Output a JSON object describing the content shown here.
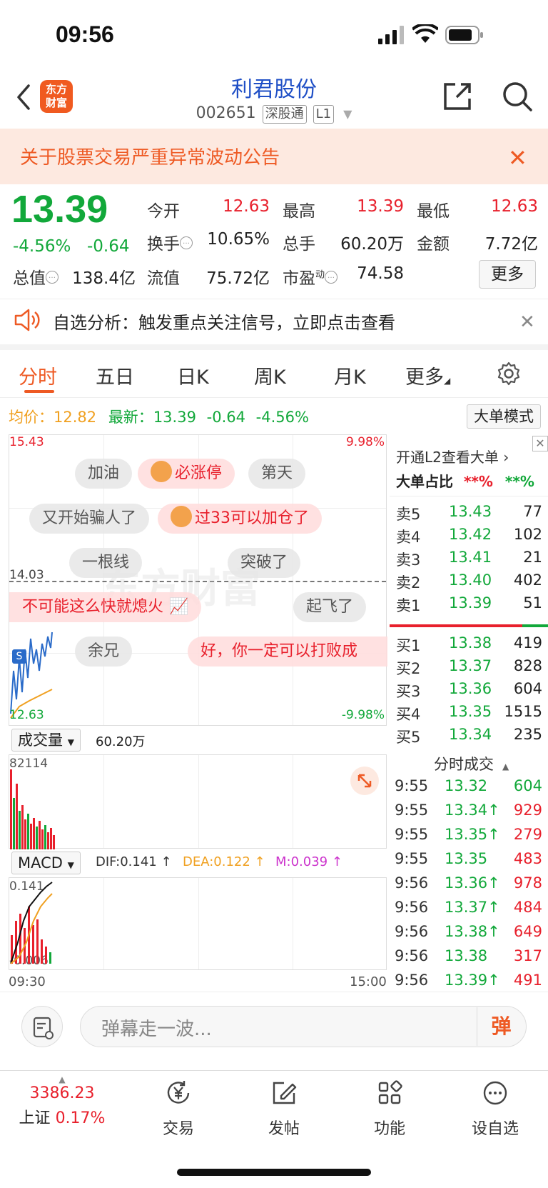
{
  "status_bar": {
    "time": "09:56"
  },
  "header": {
    "logo_line1": "东方",
    "logo_line2": "财富",
    "stock_name": "利君股份",
    "stock_code": "002651",
    "tag_connect": "深股通",
    "tag_level": "L1"
  },
  "notice": {
    "text": "关于股票交易严重异常波动公告"
  },
  "quote": {
    "price": "13.39",
    "change_pct": "-4.56%",
    "change": "-0.64",
    "fields": {
      "open_label": "今开",
      "open": "12.63",
      "high_label": "最高",
      "high": "13.39",
      "low_label": "最低",
      "low": "12.63",
      "turnover_label": "换手",
      "turnover": "10.65%",
      "volume_label": "总手",
      "volume": "60.20万",
      "amount_label": "金额",
      "amount": "7.72亿",
      "mktcap_label": "总值",
      "mktcap": "138.4亿",
      "float_label": "流值",
      "float": "75.72亿",
      "pe_label": "市盈",
      "pe_sup": "动",
      "pe": "74.58"
    },
    "more_button": "更多"
  },
  "analysis": {
    "text": "自选分析：触发重点关注信号，立即点击查看"
  },
  "tabs": [
    "分时",
    "五日",
    "日K",
    "周K",
    "月K",
    "更多"
  ],
  "avg_row": {
    "avg_label": "均价：",
    "avg": "12.82",
    "latest_label": "最新：",
    "latest": "13.39",
    "chg": "-0.64",
    "pct": "-4.56%",
    "bigorder_button": "大单模式"
  },
  "chart": {
    "top_price": "15.43",
    "top_pct": "9.98%",
    "mid_price": "14.03",
    "bottom_price": "12.63",
    "bottom_pct": "-9.98%",
    "danmu": [
      "加油",
      "必涨停",
      "第天",
      "又开始骗人了",
      "过33可以加仓了",
      "一根线",
      "突破了",
      "不可能这么快就熄火",
      "起飞了",
      "余兄",
      "好，你一定可以打败成",
      "东方财富"
    ],
    "vol_select": "成交量",
    "vol_value": "60.20万",
    "vol_max": "82114",
    "macd_select": "MACD",
    "dif": "DIF:0.141 ↑",
    "dea": "DEA:0.122 ↑",
    "m": "M:0.039 ↑",
    "macd_top": "0.141",
    "macd_bottom": "-0.006",
    "time_start": "09:30",
    "time_end": "15:00"
  },
  "right_panel": {
    "l2_link": "开通L2查看大单 ›",
    "bigorder_label": "大单占比",
    "bigorder_red": "**%",
    "bigorder_green": "**%",
    "sells": [
      {
        "label": "卖5",
        "price": "13.43",
        "vol": "77"
      },
      {
        "label": "卖4",
        "price": "13.42",
        "vol": "102"
      },
      {
        "label": "卖3",
        "price": "13.41",
        "vol": "21"
      },
      {
        "label": "卖2",
        "price": "13.40",
        "vol": "402"
      },
      {
        "label": "卖1",
        "price": "13.39",
        "vol": "51"
      }
    ],
    "buys": [
      {
        "label": "买1",
        "price": "13.38",
        "vol": "419"
      },
      {
        "label": "买2",
        "price": "13.37",
        "vol": "828"
      },
      {
        "label": "买3",
        "price": "13.36",
        "vol": "604"
      },
      {
        "label": "买4",
        "price": "13.35",
        "vol": "1515"
      },
      {
        "label": "买5",
        "price": "13.34",
        "vol": "235"
      }
    ],
    "ticks_title": "分时成交",
    "ticks": [
      {
        "time": "9:55",
        "price": "13.32",
        "vol": "604",
        "color": "green"
      },
      {
        "time": "9:55",
        "price": "13.34↑",
        "vol": "929",
        "color": "red"
      },
      {
        "time": "9:55",
        "price": "13.35↑",
        "vol": "279",
        "color": "red"
      },
      {
        "time": "9:55",
        "price": "13.35",
        "vol": "483",
        "color": "red"
      },
      {
        "time": "9:56",
        "price": "13.36↑",
        "vol": "978",
        "color": "red"
      },
      {
        "time": "9:56",
        "price": "13.37↑",
        "vol": "484",
        "color": "red"
      },
      {
        "time": "9:56",
        "price": "13.38↑",
        "vol": "649",
        "color": "red"
      },
      {
        "time": "9:56",
        "price": "13.38",
        "vol": "317",
        "color": "red"
      },
      {
        "time": "9:56",
        "price": "13.39↑",
        "vol": "491",
        "color": "red"
      }
    ]
  },
  "comment_bar": {
    "placeholder": "弹幕走一波...",
    "send_label": "弹"
  },
  "bottom_bar": {
    "index_value": "3386.23",
    "index_name": "上证",
    "index_pct": "0.17%",
    "trade_label": "交易",
    "post_label": "发帖",
    "func_label": "功能",
    "watch_label": "设自选"
  },
  "colors": {
    "up": "#e8202c",
    "down": "#12a83a",
    "accent": "#ee5a24",
    "name_blue": "#1f4fc6"
  }
}
